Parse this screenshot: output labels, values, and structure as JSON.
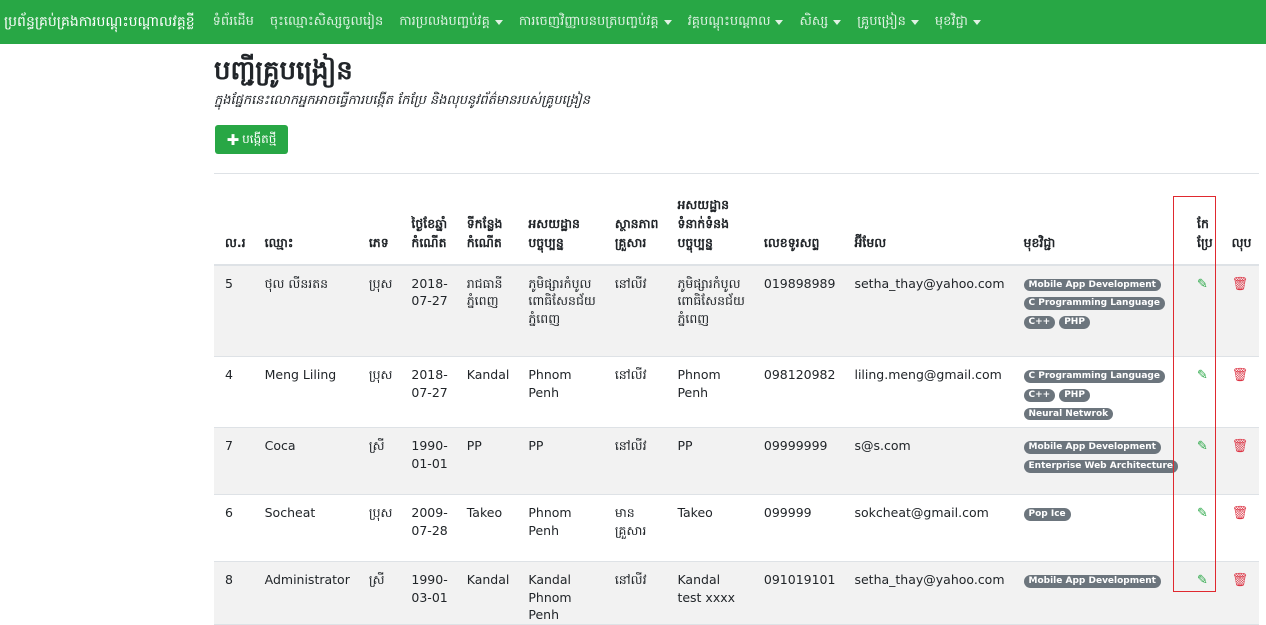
{
  "navbar": {
    "brand": "ប្រព័ន្ធគ្រប់គ្រងការបណ្តុះបណ្តាលវគ្គខ្លី",
    "items": [
      {
        "label": "ទំព័រដើម",
        "dropdown": false
      },
      {
        "label": "ចុះឈ្មោះសិស្សចូលរៀន",
        "dropdown": false
      },
      {
        "label": "ការប្រលងបញ្ចប់វគ្គ",
        "dropdown": true
      },
      {
        "label": "ការចេញវិញ្ញាបនបត្របញ្ចប់វគ្គ",
        "dropdown": true
      },
      {
        "label": "វគ្គបណ្តុះបណ្តាល",
        "dropdown": true
      },
      {
        "label": "សិស្ស",
        "dropdown": true
      },
      {
        "label": "គ្រូបង្រៀន",
        "dropdown": true
      },
      {
        "label": "មុខវិជ្ជា",
        "dropdown": true
      }
    ]
  },
  "page": {
    "title": "បញ្ជីគ្រូបង្រៀន",
    "subtitle": "ក្នុងផ្នែកនេះលោកអ្នកអាចធ្វើការបង្កើត កែប្រែ និងលុបនូវព័ត៌មានរបស់គ្រូបង្រៀន",
    "create_button": "បង្កើតថ្មី"
  },
  "table": {
    "headers": {
      "id": "ល.រ",
      "name": "ឈ្មោះ",
      "sex": "ភេទ",
      "dob": "ថ្ងៃខែឆ្នាំកំណើត",
      "pob": "ទីកន្លែងកំណើត",
      "address": "អសយដ្ឋានបច្ចុប្បន្ន",
      "family": "ស្ថានភាពគ្រួសារ",
      "contact_address": "អសយដ្ឋានទំនាក់ទំនងបច្ចុប្បន្ន",
      "phone": "លេខទូរសព្ទ",
      "email": "អ៊ីមែល",
      "subjects": "មុខវិជ្ជា",
      "edit": "កែប្រែ",
      "delete": "លុប"
    },
    "rows": [
      {
        "id": "5",
        "name": "ថុល លីនរតន",
        "sex": "ប្រុស",
        "dob": "2018-07-27",
        "pob": "រាជធានីភ្នំពេញ",
        "address": "ភូមិផ្សារកំបូល ពោធិសែនជ័យ ភ្នំពេញ",
        "family": "នៅលីវ",
        "contact_address": "ភូមិផ្សារកំបូល ពោធិសែនជ័យ ភ្នំពេញ",
        "phone": "019898989",
        "email": "setha_thay@yahoo.com",
        "subjects": [
          "Mobile App Development",
          "C Programming Language",
          "C++",
          "PHP"
        ]
      },
      {
        "id": "4",
        "name": "Meng Liling",
        "sex": "ប្រុស",
        "dob": "2018-07-27",
        "pob": "Kandal",
        "address": "Phnom Penh",
        "family": "នៅលីវ",
        "contact_address": "Phnom Penh",
        "phone": "098120982",
        "email": "liling.meng@gmail.com",
        "subjects": [
          "C Programming Language",
          "C++",
          "PHP",
          "Neural Netwrok"
        ]
      },
      {
        "id": "7",
        "name": "Coca",
        "sex": "ស្រី",
        "dob": "1990-01-01",
        "pob": "PP",
        "address": "PP",
        "family": "នៅលីវ",
        "contact_address": "PP",
        "phone": "09999999",
        "email": "s@s.com",
        "subjects": [
          "Mobile App Development",
          "Enterprise Web Architecture"
        ]
      },
      {
        "id": "6",
        "name": "Socheat",
        "sex": "ប្រុស",
        "dob": "2009-07-28",
        "pob": "Takeo",
        "address": "Phnom Penh",
        "family": "មានគ្រួសារ",
        "contact_address": "Takeo",
        "phone": "099999",
        "email": "sokcheat@gmail.com",
        "subjects": [
          "Pop Ice"
        ]
      },
      {
        "id": "8",
        "name": "Administrator",
        "sex": "ស្រី",
        "dob": "1990-03-01",
        "pob": "Kandal",
        "address": "Kandal Phnom Penh",
        "family": "នៅលីវ",
        "contact_address": "Kandal test xxxx",
        "phone": "091019101",
        "email": "setha_thay@yahoo.com",
        "subjects": [
          "Mobile App Development"
        ]
      }
    ]
  },
  "icons": {
    "edit": "pencil-icon",
    "delete": "trash-icon",
    "plus": "plus-icon"
  },
  "colors": {
    "navbar": "#28a745",
    "badge": "#6c757d",
    "edit": "#28a745",
    "delete": "#dc3545",
    "highlight": "#e0292f"
  }
}
